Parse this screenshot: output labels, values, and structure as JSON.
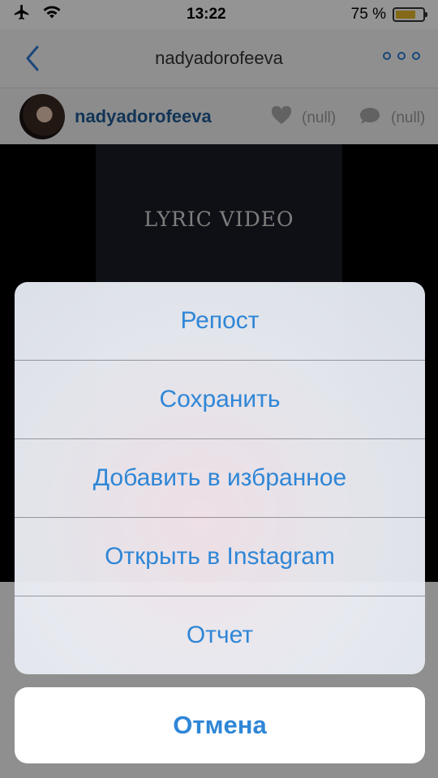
{
  "status_bar": {
    "time": "13:22",
    "battery_text": "75 %",
    "battery_level": 0.75
  },
  "nav": {
    "title": "nadyadorofeeva"
  },
  "profile": {
    "username": "nadyadorofeeva",
    "likes": "(null)",
    "comments": "(null)"
  },
  "media": {
    "caption": "LYRIC VIDEO"
  },
  "action_sheet": {
    "items": [
      {
        "label": "Репост"
      },
      {
        "label": "Сохранить"
      },
      {
        "label": "Добавить в избранное"
      },
      {
        "label": "Открыть в Instagram"
      },
      {
        "label": "Отчет"
      }
    ],
    "cancel_label": "Отмена"
  },
  "colors": {
    "accent": "#2f86d6",
    "username": "#1e5b95",
    "battery": "#e3b52a"
  }
}
